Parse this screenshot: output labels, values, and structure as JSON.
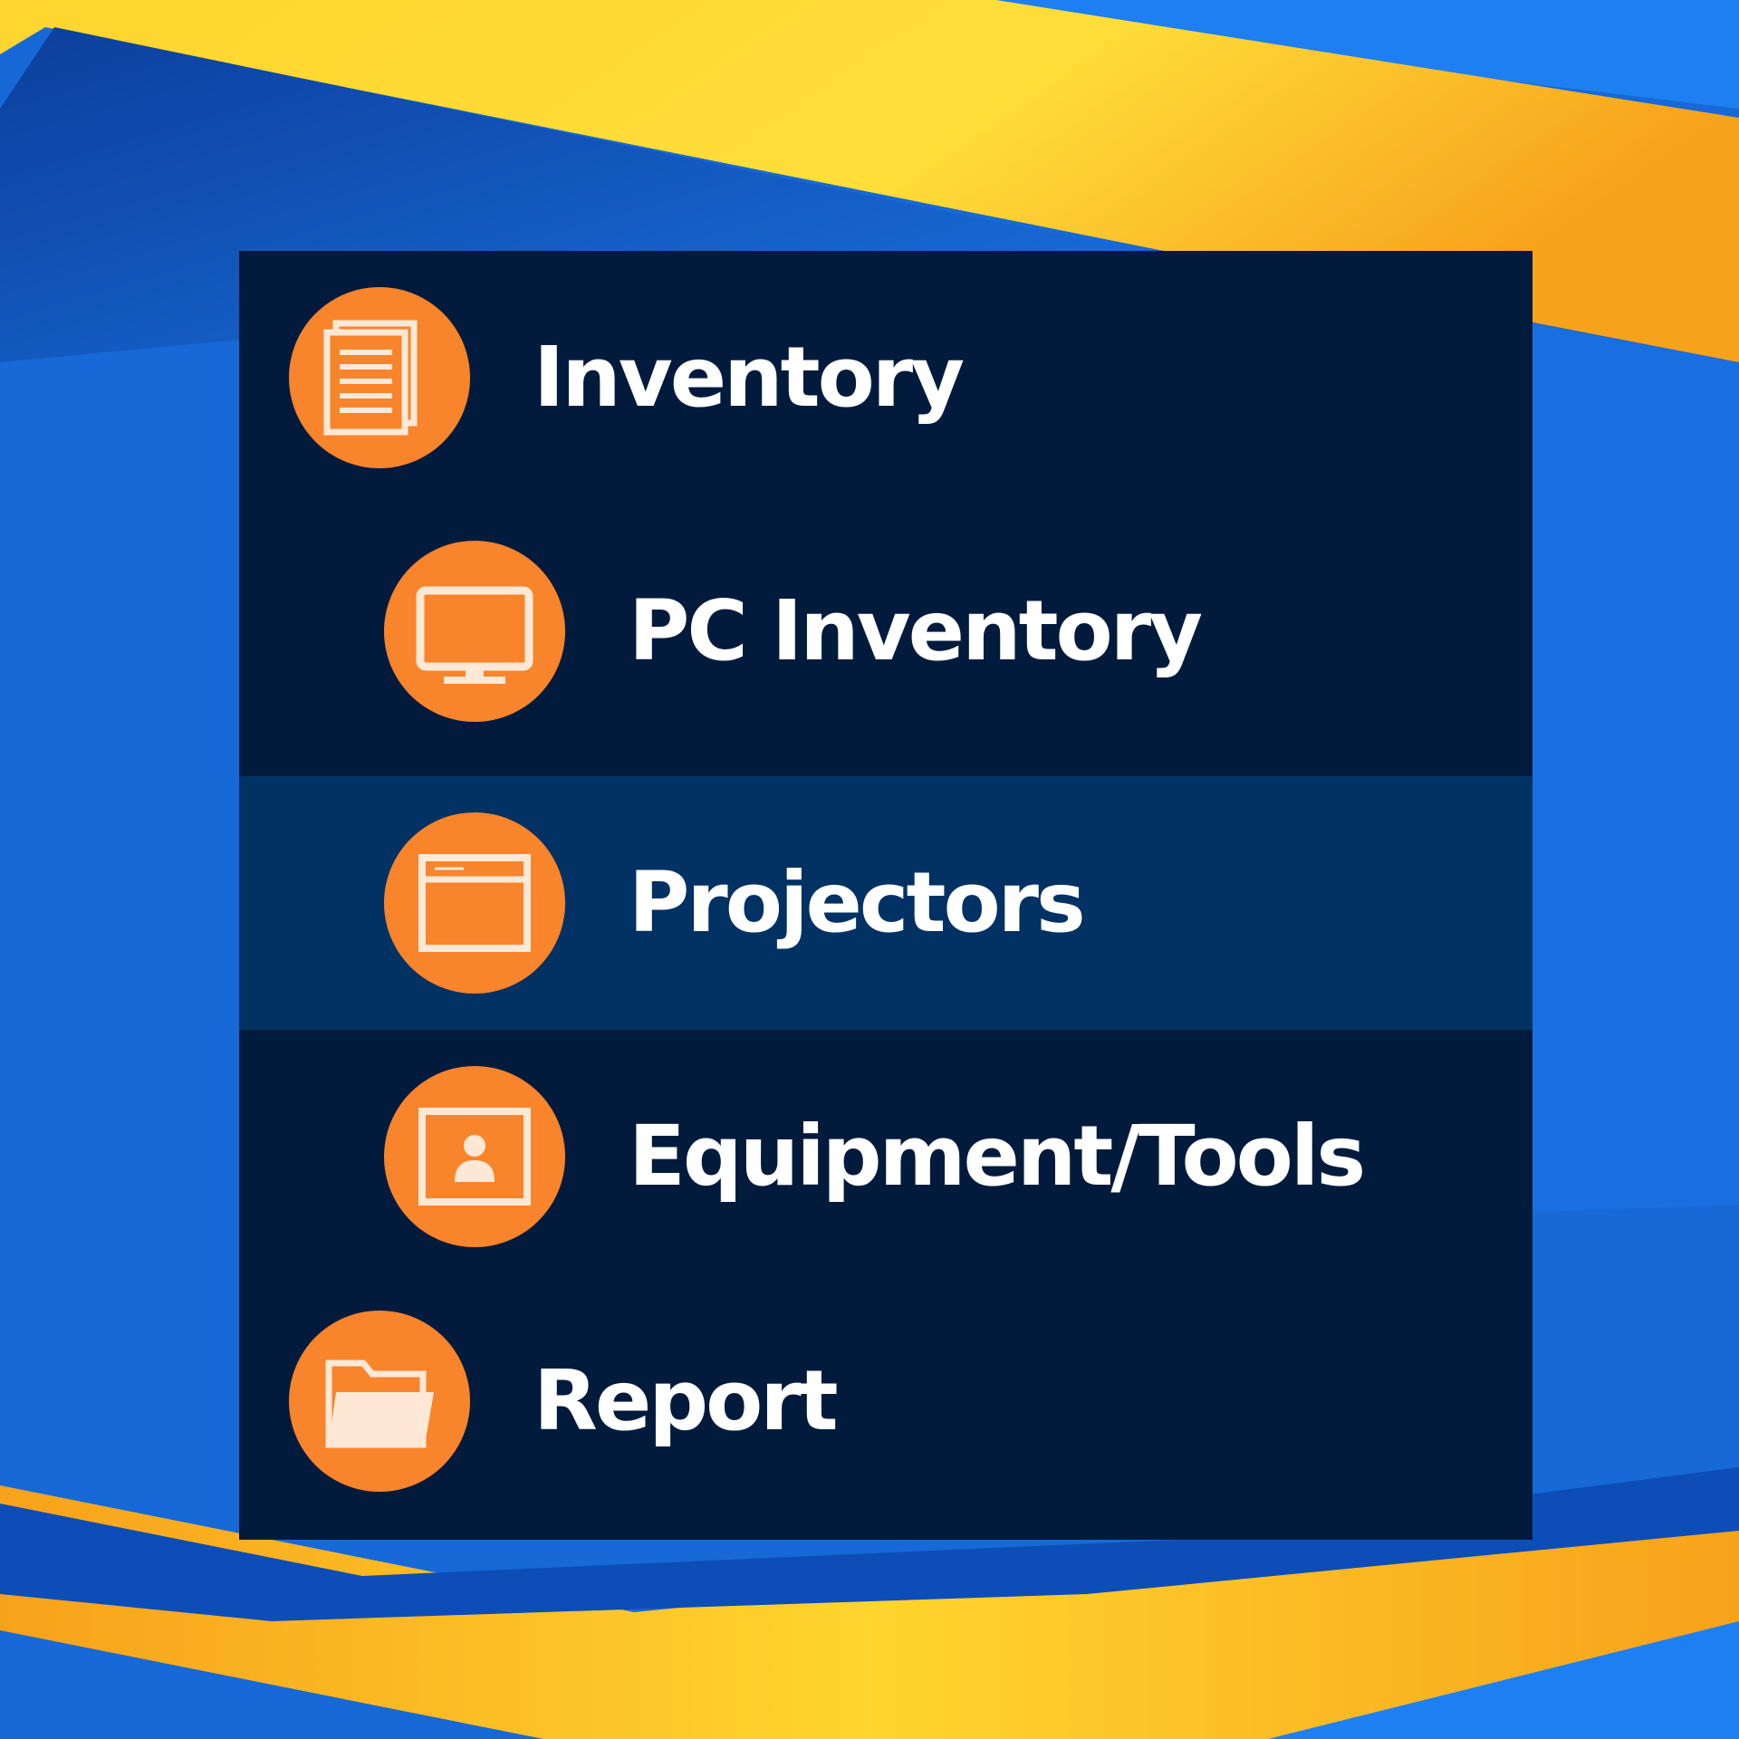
{
  "colors": {
    "panel_bg": "#021b3d",
    "active_bg": "#023163",
    "icon_circle": "#f8842b",
    "label_text": "#ffffff",
    "background_blue": "#1669d6",
    "background_yellow": "#ffd52e",
    "background_orange": "#f7a21b"
  },
  "menu": {
    "items": [
      {
        "label": "Inventory",
        "icon": "document-icon",
        "level": 1,
        "active": false
      },
      {
        "label": "PC Inventory",
        "icon": "monitor-icon",
        "level": 2,
        "active": false
      },
      {
        "label": "Projectors",
        "icon": "window-icon",
        "level": 2,
        "active": true
      },
      {
        "label": "Equipment/Tools",
        "icon": "user-card-icon",
        "level": 2,
        "active": false
      },
      {
        "label": "Report",
        "icon": "folder-icon",
        "level": 1,
        "active": false
      }
    ]
  }
}
